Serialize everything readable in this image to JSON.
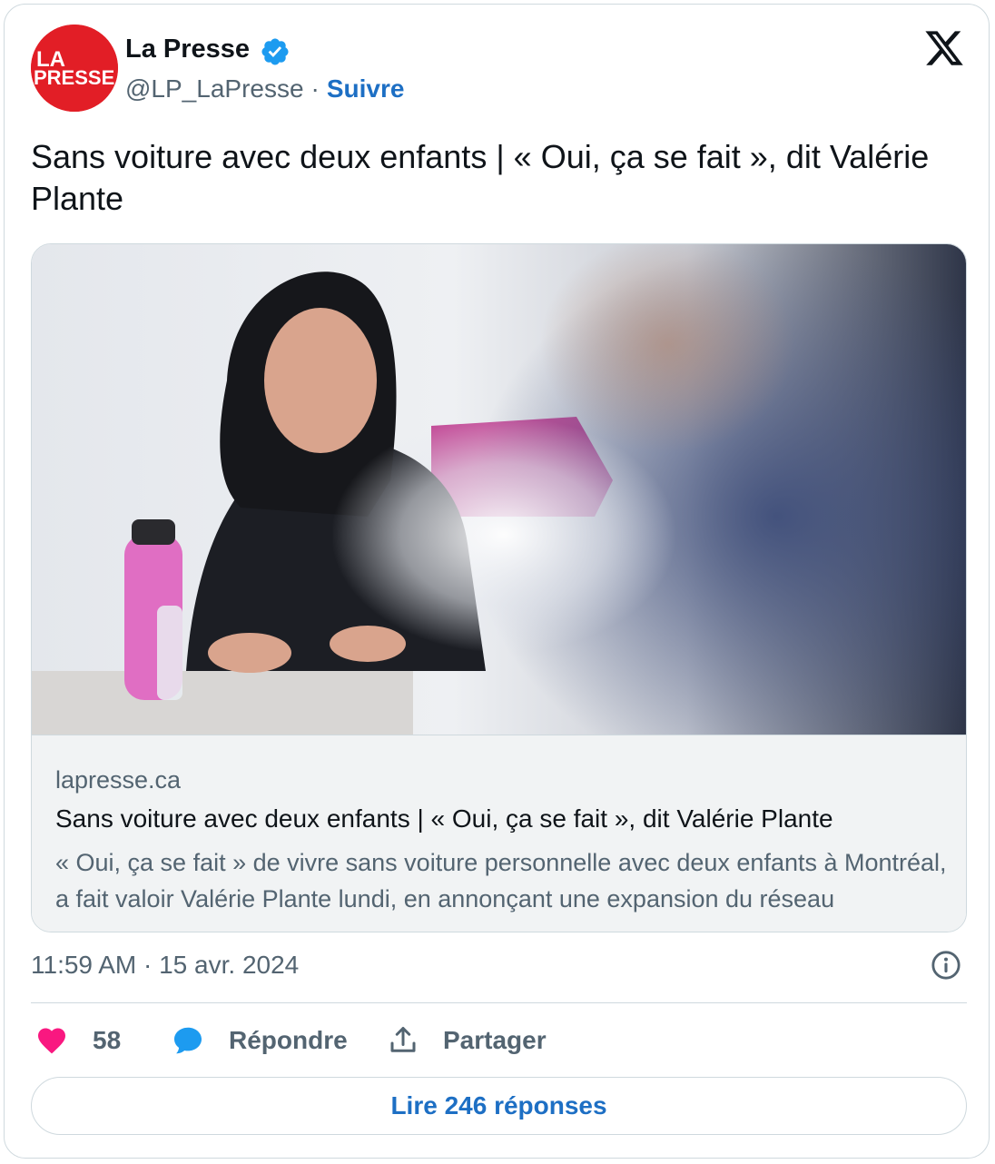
{
  "author": {
    "name": "La Presse",
    "handle": "@LP_LaPresse",
    "separator": "·",
    "follow_label": "Suivre",
    "avatar_text_line1": "LA",
    "avatar_text_line2": "PRESSE",
    "avatar_color": "#e21e26",
    "verified_icon": "verified-badge-icon"
  },
  "platform_icon": "x-logo-icon",
  "tweet": {
    "text": "Sans voiture avec deux enfants | « Oui, ça se fait », dit Valérie Plante"
  },
  "link_card": {
    "domain": "lapresse.ca",
    "title": "Sans voiture avec deux enfants | « Oui, ça se fait », dit Valérie Plante",
    "description": "« Oui, ça se fait » de vivre sans voiture personnelle avec deux enfants à Montréal, a fait valoir Valérie Plante lundi, en annonçant une expansion du réseau"
  },
  "meta": {
    "timestamp": "11:59 AM · 15 avr. 2024",
    "info_icon": "info-icon"
  },
  "actions": {
    "like_count": "58",
    "reply_label": "Répondre",
    "share_label": "Partager",
    "like_color": "#f91880",
    "reply_color": "#1d9bf0"
  },
  "read_replies_label": "Lire 246 réponses",
  "accent_color": "#1d6fc4"
}
